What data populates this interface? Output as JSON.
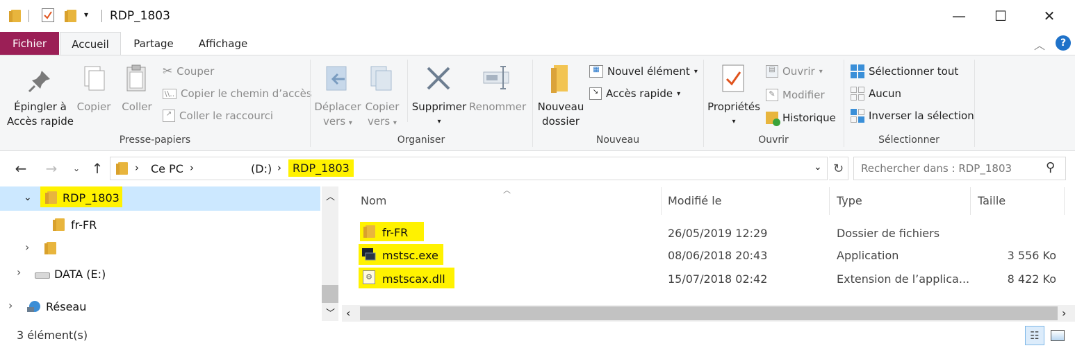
{
  "window": {
    "title": "RDP_1803",
    "minimize": "—",
    "maximize": "☐",
    "close": "✕"
  },
  "ribbon_tabs": {
    "file": "Fichier",
    "home": "Accueil",
    "share": "Partage",
    "view": "Affichage"
  },
  "help": "?",
  "clipboard": {
    "pin_line1": "Épingler à",
    "pin_line2": "Accès rapide",
    "copy": "Copier",
    "paste": "Coller",
    "cut": "Couper",
    "copy_path": "Copier le chemin d’accès",
    "paste_shortcut": "Coller le raccourci",
    "label": "Presse-papiers"
  },
  "organize": {
    "move_line1": "Déplacer",
    "move_line2": "vers",
    "copyto_line1": "Copier",
    "copyto_line2": "vers",
    "delete": "Supprimer",
    "rename": "Renommer",
    "label": "Organiser"
  },
  "new": {
    "folder_line1": "Nouveau",
    "folder_line2": "dossier",
    "new_item": "Nouvel élément",
    "quick_access": "Accès rapide",
    "label": "Nouveau"
  },
  "open": {
    "properties": "Propriétés",
    "open": "Ouvrir",
    "edit": "Modifier",
    "history": "Historique",
    "label": "Ouvrir"
  },
  "select": {
    "select_all": "Sélectionner tout",
    "none": "Aucun",
    "invert": "Inverser la sélection",
    "label": "Sélectionner"
  },
  "address": {
    "this_pc": "Ce PC",
    "drive": "(D:)",
    "current": "RDP_1803",
    "search_placeholder": "Rechercher dans : RDP_1803"
  },
  "tree": {
    "items": [
      {
        "label": "RDP_1803"
      },
      {
        "label": "fr-FR"
      },
      {
        "label": ""
      },
      {
        "label": "DATA (E:)"
      },
      {
        "label": "Réseau"
      }
    ]
  },
  "columns": {
    "name": "Nom",
    "modified": "Modifié le",
    "type": "Type",
    "size": "Taille"
  },
  "files": [
    {
      "name": "fr-FR",
      "modified": "26/05/2019 12:29",
      "type": "Dossier de fichiers",
      "size": ""
    },
    {
      "name": "mstsc.exe",
      "modified": "08/06/2018 20:43",
      "type": "Application",
      "size": "3 556 Ko"
    },
    {
      "name": "mstscax.dll",
      "modified": "15/07/2018 02:42",
      "type": "Extension de l’applica...",
      "size": "8 422 Ko"
    }
  ],
  "status": "3 élément(s)",
  "colors": {
    "file_tab": "#9b1f56",
    "highlight": "#fff200",
    "selection": "#cce8ff",
    "ribbon_bg": "#f5f6f7"
  }
}
